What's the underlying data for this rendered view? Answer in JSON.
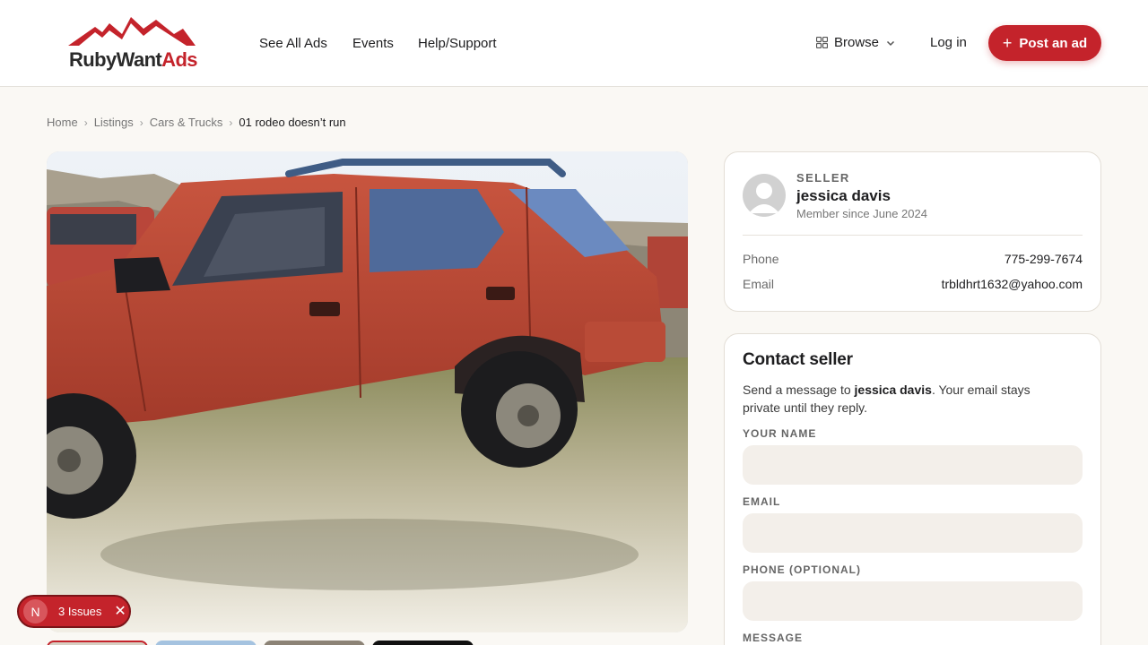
{
  "header": {
    "logo_text_part1": "RubyWant",
    "logo_text_part2": "Ads",
    "nav": [
      "See All Ads",
      "Events",
      "Help/Support"
    ],
    "browse_label": "Browse",
    "login_label": "Log in",
    "post_label": "Post an ad"
  },
  "breadcrumb": [
    "Home",
    "Listings",
    "Cars & Trucks",
    "01 rodeo doesn’t run"
  ],
  "seller": {
    "eyebrow": "SELLER",
    "name": "jessica davis",
    "since": "Member since June 2024",
    "phone_label": "Phone",
    "phone": "775-299-7674",
    "email_label": "Email",
    "email": "trbldhrt1632@yahoo.com"
  },
  "contact": {
    "title": "Contact seller",
    "desc_prefix": "Send a message to ",
    "desc_name": "jessica davis",
    "desc_suffix": ". Your email stays private until they reply.",
    "name_label": "YOUR NAME",
    "email_label": "EMAIL",
    "phone_label": "PHONE (OPTIONAL)",
    "message_label": "MESSAGE"
  },
  "issues_badge": {
    "initial": "N",
    "label": "3 Issues"
  },
  "colors": {
    "brand": "#c4232b",
    "background": "#faf8f4",
    "field_bg": "#f3efea"
  }
}
